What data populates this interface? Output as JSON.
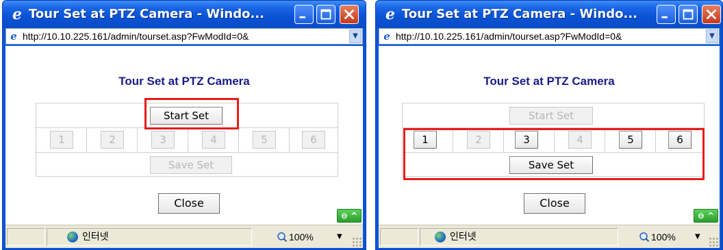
{
  "windows": [
    {
      "title": "Tour Set at PTZ Camera - Windo...",
      "url": "http://10.10.225.161/admin/tourset.asp?FwModId=0&",
      "page_title": "Tour Set at PTZ Camera",
      "start_set_label": "Start Set",
      "start_set_enabled": true,
      "slots": [
        {
          "label": "1",
          "enabled": false
        },
        {
          "label": "2",
          "enabled": false
        },
        {
          "label": "3",
          "enabled": false
        },
        {
          "label": "4",
          "enabled": false
        },
        {
          "label": "5",
          "enabled": false
        },
        {
          "label": "6",
          "enabled": false
        }
      ],
      "save_set_label": "Save Set",
      "save_set_enabled": false,
      "close_label": "Close",
      "status_zone": "인터넷",
      "zoom": "100%",
      "highlight": "start-set"
    },
    {
      "title": "Tour Set at PTZ Camera - Windo...",
      "url": "http://10.10.225.161/admin/tourset.asp?FwModId=0&",
      "page_title": "Tour Set at PTZ Camera",
      "start_set_label": "Start Set",
      "start_set_enabled": false,
      "slots": [
        {
          "label": "1",
          "enabled": true
        },
        {
          "label": "2",
          "enabled": false
        },
        {
          "label": "3",
          "enabled": true
        },
        {
          "label": "4",
          "enabled": false
        },
        {
          "label": "5",
          "enabled": true
        },
        {
          "label": "6",
          "enabled": true
        }
      ],
      "save_set_label": "Save Set",
      "save_set_enabled": true,
      "close_label": "Close",
      "status_zone": "인터넷",
      "zoom": "100%",
      "highlight": "slots-and-save"
    }
  ],
  "colors": {
    "highlight": "#e61b1b",
    "title_text": "#1a1a8a",
    "titlebar_blue": "#0a52d4"
  },
  "icons": {
    "title": "ie-logo-icon",
    "page": "ie-page-icon",
    "status_zone": "globe-icon",
    "zoom": "magnifier-icon"
  }
}
